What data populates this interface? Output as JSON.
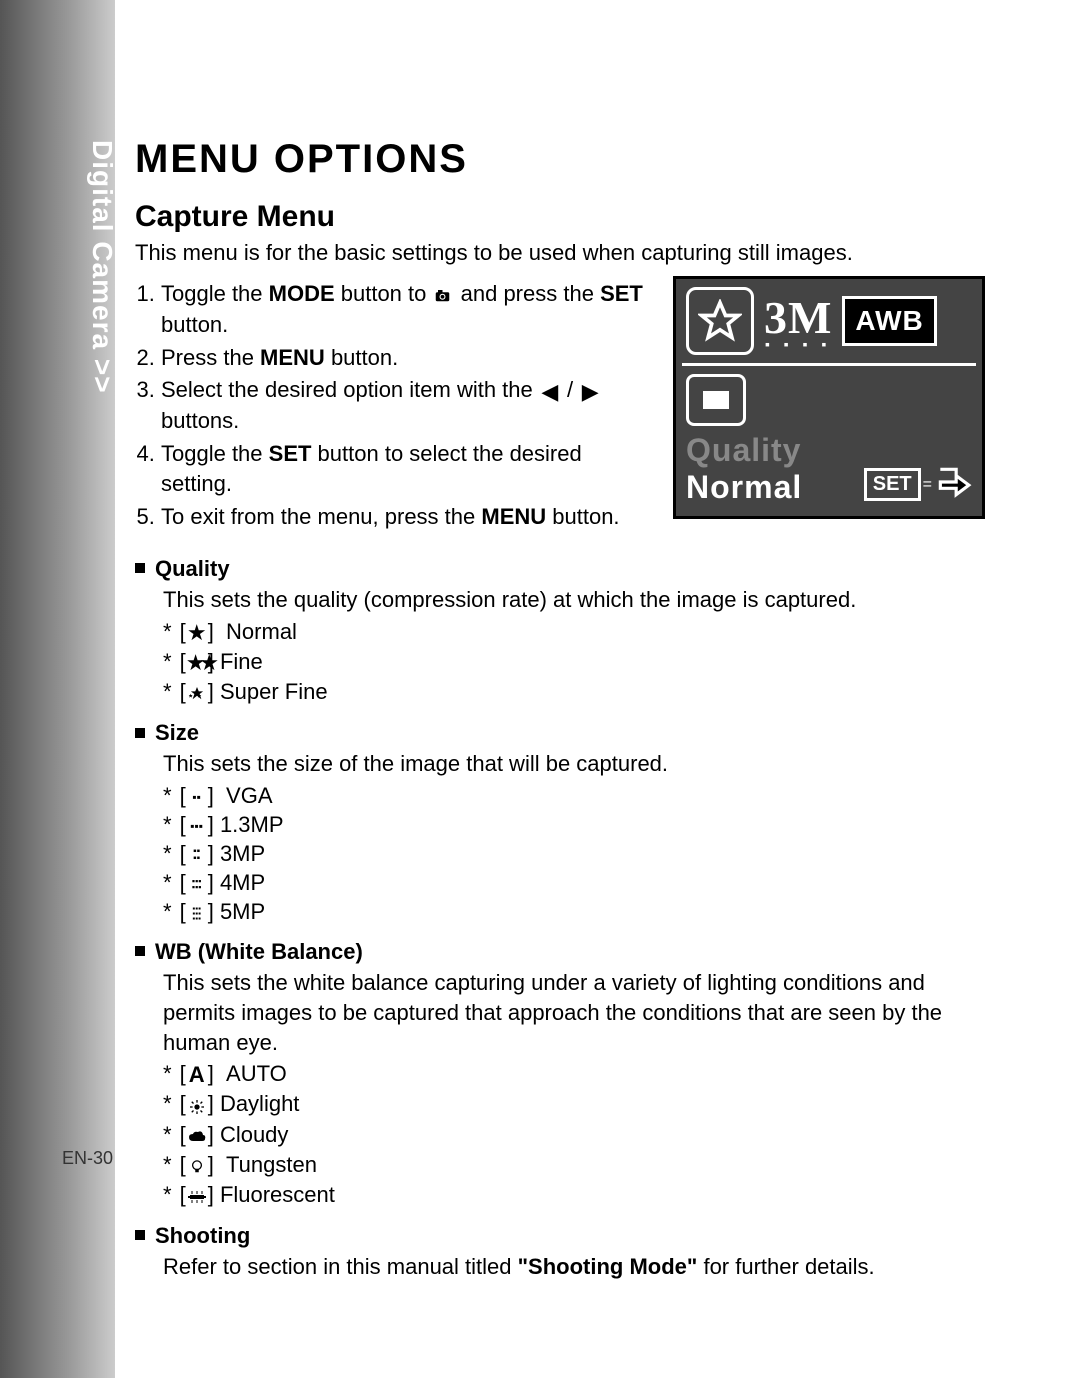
{
  "sidebar": {
    "label": "Digital Camera >>"
  },
  "page_number": "EN-30",
  "h1": "MENU OPTIONS",
  "h2": "Capture Menu",
  "intro": "This menu is for the basic settings to be used when capturing still images.",
  "steps": {
    "s1a": "Toggle the ",
    "s1_mode": "MODE",
    "s1b": " button to ",
    "s1c": " and press the ",
    "s1_set": "SET",
    "s1d": " button.",
    "s2a": "Press the ",
    "s2_menu": "MENU",
    "s2b": " button.",
    "s3a": "Select the desired option item with the ",
    "s3b": " / ",
    "s3c": " buttons.",
    "s4a": "Toggle the ",
    "s4_set": "SET",
    "s4b": " button to select the desired setting.",
    "s5a": "To exit from the menu, press the ",
    "s5_menu": "MENU",
    "s5b": " button."
  },
  "lcd": {
    "size": "3M",
    "dots": "▪ ▪ ▪ ▪",
    "awb": "AWB",
    "quality_label": "Quality",
    "quality_value": "Normal",
    "set": "SET"
  },
  "quality": {
    "title": "Quality",
    "desc": "This sets the quality (compression rate) at which the image is captured.",
    "opts": [
      "Normal",
      "Fine",
      "Super Fine"
    ]
  },
  "size": {
    "title": "Size",
    "desc": "This sets the size of the image that will be captured.",
    "opts": [
      "VGA",
      "1.3MP",
      "3MP",
      "4MP",
      "5MP"
    ]
  },
  "wb": {
    "title": "WB (White Balance)",
    "desc": "This sets the white balance capturing under a variety of lighting conditions and permits images to be captured that approach the conditions that are seen by the human eye.",
    "opts": [
      "AUTO",
      "Daylight",
      "Cloudy",
      "Tungsten",
      "Fluorescent"
    ],
    "auto_sym": "A"
  },
  "shooting": {
    "title": "Shooting",
    "desc_a": "Refer to section in this manual titled ",
    "desc_b": "\"Shooting Mode\"",
    "desc_c": " for further details."
  }
}
